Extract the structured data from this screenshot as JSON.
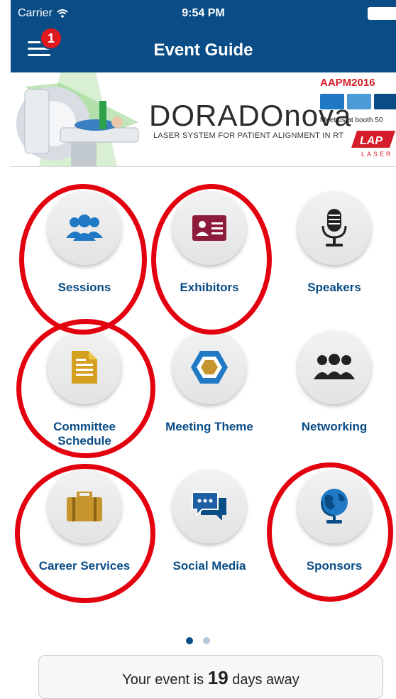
{
  "status_bar": {
    "carrier": "Carrier",
    "time": "9:54 PM"
  },
  "header": {
    "title": "Event Guide",
    "notification_count": "1"
  },
  "banner": {
    "brand": "DORADOnova",
    "tagline": "LASER SYSTEM FOR PATIENT ALIGNMENT IN RT",
    "aapm_text": "AAPM2016",
    "booth_text": "Meet us at booth 50",
    "lap_text": "LAP",
    "laser_text": "LASER"
  },
  "tiles": [
    {
      "label": "Sessions",
      "icon": "users-icon",
      "highlighted": true
    },
    {
      "label": "Exhibitors",
      "icon": "id-card-icon",
      "highlighted": true
    },
    {
      "label": "Speakers",
      "icon": "microphone-icon",
      "highlighted": false
    },
    {
      "label": "Committee Schedule",
      "icon": "document-icon",
      "highlighted": true
    },
    {
      "label": "Meeting Theme",
      "icon": "hexagon-icon",
      "highlighted": false
    },
    {
      "label": "Networking",
      "icon": "group-icon",
      "highlighted": false
    },
    {
      "label": "Career Services",
      "icon": "briefcase-icon",
      "highlighted": true
    },
    {
      "label": "Social Media",
      "icon": "chat-icon",
      "highlighted": false
    },
    {
      "label": "Sponsors",
      "icon": "globe-icon",
      "highlighted": true
    }
  ],
  "pager": {
    "pages": 2,
    "active": 1
  },
  "countdown": {
    "prefix": "Your event is",
    "days": "19",
    "suffix": "days away"
  },
  "colors": {
    "header_bg": "#0a4c86",
    "label": "#0a4c86",
    "highlight_ring": "#e3000f",
    "badge": "#e0191e"
  }
}
